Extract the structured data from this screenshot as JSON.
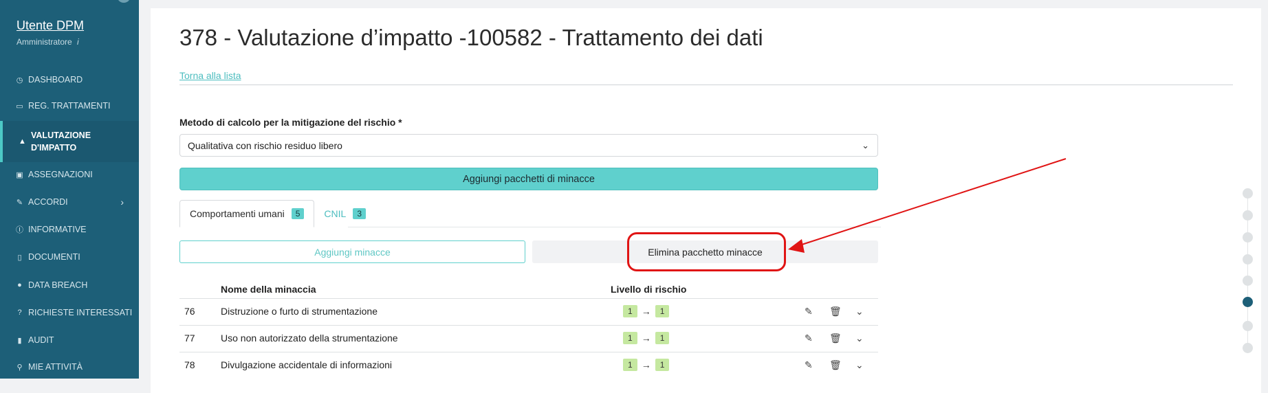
{
  "sidebar": {
    "user_name": "Utente DPM",
    "user_role": "Amministratore",
    "user_role_info_icon": "i",
    "items": [
      {
        "label": "DASHBOARD",
        "icon": "gauge-icon",
        "glyph": "◷"
      },
      {
        "label": "REG. TRATTAMENTI",
        "icon": "book-icon",
        "glyph": "▭"
      },
      {
        "label": "VALUTAZIONE D'IMPATTO",
        "icon": "warning-icon",
        "glyph": "▲"
      },
      {
        "label": "ASSEGNAZIONI",
        "icon": "clipboard-icon",
        "glyph": "▣"
      },
      {
        "label": "ACCORDI",
        "icon": "handshake-icon",
        "glyph": "✎"
      },
      {
        "label": "INFORMATIVE",
        "icon": "info-icon",
        "glyph": "ⓘ"
      },
      {
        "label": "DOCUMENTI",
        "icon": "document-icon",
        "glyph": "▯"
      },
      {
        "label": "DATA BREACH",
        "icon": "alert-circle-icon",
        "glyph": "●"
      },
      {
        "label": "RICHIESTE INTERESSATI",
        "icon": "help-icon",
        "glyph": "?"
      },
      {
        "label": "AUDIT",
        "icon": "bar-chart-icon",
        "glyph": "▮"
      },
      {
        "label": "MIE ATTIVITÀ",
        "icon": "pin-icon",
        "glyph": "⚲"
      }
    ],
    "chevron_glyph": "›"
  },
  "main": {
    "title": "378 - Valutazione d’impatto -100582 - Trattamento dei dati",
    "back_link": "Torna alla lista",
    "method_label": "Metodo di calcolo per la mitigazione del rischio *",
    "method_value": "Qualitativa con rischio residuo libero",
    "caret_glyph": "⌄",
    "add_packs_label": "Aggiungi pacchetti di minacce",
    "tabs": [
      {
        "label": "Comportamenti umani",
        "count": "5"
      },
      {
        "label": "CNIL",
        "count": "3"
      }
    ],
    "add_threats_label": "Aggiungi minacce",
    "delete_pack_label": "Elimina pacchetto minacce",
    "table": {
      "col_name": "Nome della minaccia",
      "col_risk": "Livello di rischio",
      "arrow_glyph": "→",
      "edit_glyph": "✎",
      "delete_glyph": "🗑",
      "expand_glyph": "⌄",
      "rows": [
        {
          "id": "76",
          "name": "Distruzione o furto di strumentazione",
          "risk_from": "1",
          "risk_to": "1"
        },
        {
          "id": "77",
          "name": "Uso non autorizzato della strumentazione",
          "risk_from": "1",
          "risk_to": "1"
        },
        {
          "id": "78",
          "name": "Divulgazione accidentale di informazioni",
          "risk_from": "1",
          "risk_to": "1"
        }
      ]
    }
  },
  "colors": {
    "sidebar_bg": "#1d5f78",
    "accent": "#5fd0cd",
    "risk_chip": "#c5e8a0",
    "highlight": "#e01414"
  },
  "stepper": {
    "total": 8,
    "current_index": 5
  }
}
